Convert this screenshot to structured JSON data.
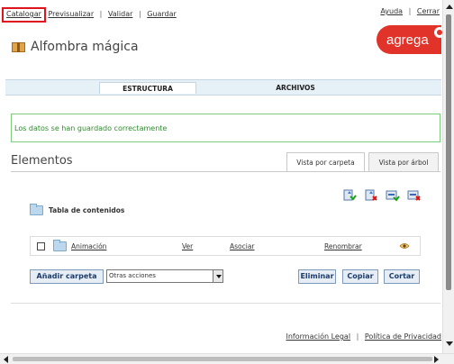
{
  "top_nav": {
    "items": [
      "Catalogar",
      "Previsualizar",
      "Validar",
      "Guardar"
    ],
    "active": "Catalogar",
    "separator": "|"
  },
  "top_links": {
    "help": "Ayuda",
    "close": "Cerrar",
    "separator": "|"
  },
  "logo": {
    "text": "agrega"
  },
  "page": {
    "title": "Alfombra mágica",
    "icon": "box-icon"
  },
  "tabs": [
    {
      "label": "ESTRUCTURA",
      "selected": true
    },
    {
      "label": "ARCHIVOS",
      "selected": false
    }
  ],
  "message": {
    "text": "Los datos se han guardado correctamente"
  },
  "elements": {
    "title": "Elementos",
    "view_tabs": [
      {
        "label": "Vista por carpeta",
        "selected": true
      },
      {
        "label": "Vista por árbol",
        "selected": false
      }
    ],
    "toolbar_icons": [
      "add-resource-icon",
      "delete-resource-icon",
      "move-in-icon",
      "remove-item-icon"
    ],
    "toc_label": "Tabla de contenidos",
    "rows": [
      {
        "name": "Animación",
        "view": "Ver",
        "associate": "Asociar",
        "rename": "Renombrar",
        "checked": false
      }
    ],
    "buttons": {
      "add_folder": "Añadir carpeta",
      "delete": "Eliminar",
      "copy": "Copiar",
      "cut": "Cortar"
    },
    "actions_select": {
      "value": "Otras acciones"
    }
  },
  "footer": {
    "legal": "Información Legal",
    "privacy": "Política de Privacidad",
    "separator": "|"
  },
  "colors": {
    "accent_red": "#e2332a",
    "success_green": "#2f8a2f",
    "tab_bg": "#e6f0f7",
    "button_text": "#1c3b6b"
  }
}
